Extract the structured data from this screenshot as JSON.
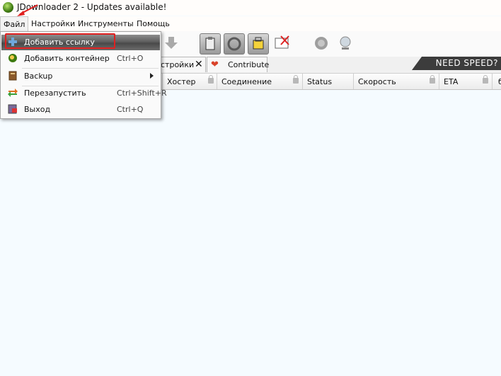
{
  "window": {
    "title": "JDownloader 2 - Updates available!"
  },
  "menubar": {
    "file": "Файл",
    "settings": "Настройки",
    "tools": "Инструменты",
    "help": "Помощь"
  },
  "tabs": {
    "settings_partial": "стройки",
    "contribute": "Contribute"
  },
  "banner": {
    "need_speed": "NEED SPEED?"
  },
  "columns": {
    "hoster": "Хостер",
    "connection": "Соединение",
    "status": "Status",
    "speed": "Скорость",
    "eta": "ETA",
    "last": "б"
  },
  "file_menu": {
    "items": [
      {
        "label": "Добавить ссылку",
        "shortcut": "",
        "icon": "plus-icon"
      },
      {
        "label": "Добавить контейнер",
        "shortcut": "Ctrl+O",
        "icon": "container-icon"
      },
      {
        "label": "Backup",
        "shortcut": "",
        "icon": "backup-icon"
      },
      {
        "label": "Перезапустить",
        "shortcut": "Ctrl+Shift+R",
        "icon": "restart-icon"
      },
      {
        "label": "Выход",
        "shortcut": "Ctrl+Q",
        "icon": "exit-icon"
      }
    ]
  },
  "colors": {
    "highlight": "#e02020",
    "content_bg": "#f5fbff"
  }
}
